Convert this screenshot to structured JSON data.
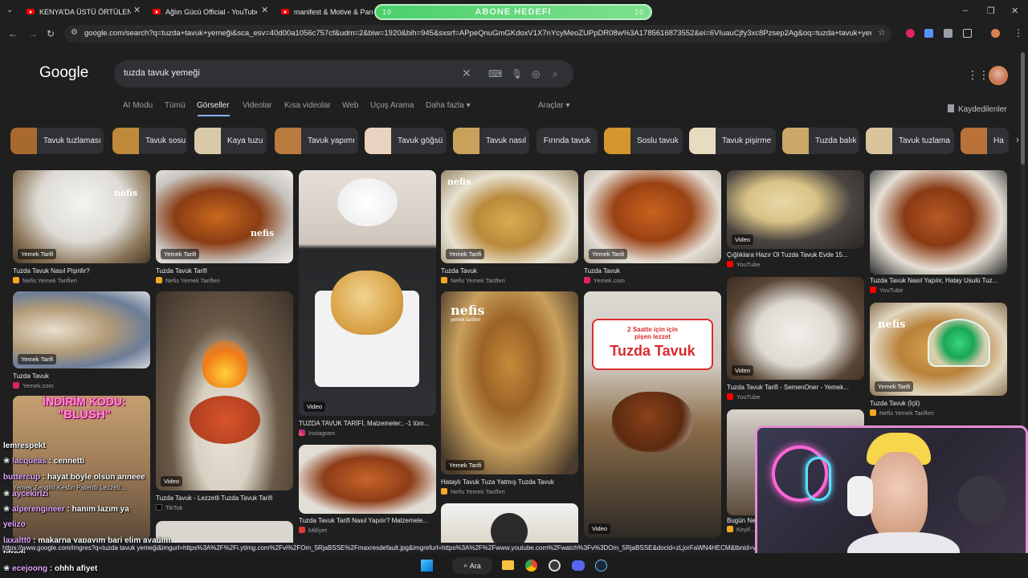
{
  "browser": {
    "tabs": [
      {
        "title": "KENYA'DA ÜSTÜ ÖRTÜLEN KOR"
      },
      {
        "title": "Ağlın Gücü Official - YouTube"
      },
      {
        "title": "manifest & Motive & Pango"
      }
    ],
    "overlay_banner": {
      "label": "ABONE HEDEFI",
      "left_num": "10",
      "right_num": "10"
    },
    "url": "google.com/search?q=tuzda+tavuk+yemeği&sca_esv=40d00a1056c757cf&udm=2&biw=1920&bih=945&sxsrf=APpeQnuGmGKdoxV1X7nYcyMeoZUPpDR08w%3A1785616873552&ei=6VIuauCjfy3xc8Pzsep2Ag&oq=tuzda+tavuk+yem..."
  },
  "google": {
    "logo": "Google",
    "query": "tuzda tavuk yemeği",
    "tabs": [
      "AI Modu",
      "Tümü",
      "Görseller",
      "Videolar",
      "Kısa videolar",
      "Web",
      "Uçuş Arama",
      "Daha fazla",
      "Araçlar"
    ],
    "active_tab": "Görseller",
    "saved": "Kaydedilenler",
    "chips": [
      "Tavuk tuzlaması",
      "Tavuk sosu",
      "Kaya tuzu",
      "Tavuk yapımı",
      "Tavuk göğsü",
      "Tavuk nasıl",
      "Fırında tavuk",
      "Soslu tavuk",
      "Tavuk pişirme",
      "Tuzda balık",
      "Tavuk tuzlama",
      "Ha"
    ],
    "results": [
      {
        "caption": "Tuzda Tavuk Nasıl Pişirilir?",
        "source": "Nefis Yemek Tarifleri",
        "badge": "Yemek Tarifi"
      },
      {
        "caption": "Tuzda Tavuk Tarifi",
        "source": "Nefis Yemek Tarifleri",
        "badge": "Yemek Tarifi"
      },
      {
        "caption": "TUZDA TAVUK TARİFİ, Malzemeler:, -1 tüm...",
        "source": "Instagram",
        "badge": "Video"
      },
      {
        "caption": "Tuzda Tavuk",
        "source": "Nefis Yemek Tarifleri",
        "badge": "Yemek Tarifi"
      },
      {
        "caption": "Tuzda Tavuk",
        "source": "Yemek.com",
        "badge": "Yemek Tarifi"
      },
      {
        "caption": "Çığlıklara Hazır Ol Tuzda Tavuk Evde 15...",
        "source": "YouTube",
        "badge": "Video"
      },
      {
        "caption": "Tuzda Tavuk Nasıl Yapılır, Hatay Usulü Tuz...",
        "source": "YouTube",
        "badge": ""
      },
      {
        "caption": "Tuzda Tavuk",
        "source": "Yemek.com",
        "badge": "Yemek Tarifi"
      },
      {
        "caption": "Tuzda Tavuk - Lezzetli Tuzda Tavuk Tarifi",
        "source": "TikTok",
        "badge": "Video"
      },
      {
        "caption": "Hataylı Tavuk Tuza Yatmış Tuzda Tavuk",
        "source": "Nefis Yemek Tarifleri",
        "badge": "Yemek Tarifi"
      },
      {
        "caption": "Tuzda Tavuk Tarifi - SemenOner - Yemek...",
        "source": "YouTube",
        "badge": "Video"
      },
      {
        "caption": "Tuzda Tavuk (İçli)",
        "source": "Nefis Yemek Tarifleri",
        "badge": "Yemek Tarifi"
      },
      {
        "caption": "Tuzda Tavuk Tarifi Nasıl Yapılır? Malzemele...",
        "source": "Milliyet",
        "badge": ""
      },
      {
        "caption": "Bugün Ne...",
        "source": "Keyif...",
        "badge": ""
      }
    ],
    "overlay_text": {
      "line1": "2 Saatte için için",
      "line2": "pişen lezzet",
      "line3": "Tuzda Tavuk",
      "nefis": "nefis",
      "nefis_sub": "yemek tarifleri",
      "video": "Video"
    }
  },
  "stream": {
    "promo": {
      "line1": "İNDİRİM KODU:",
      "line2": "\"BLUSH\""
    },
    "chat": [
      {
        "user": "",
        "msg": "lemrespekt"
      },
      {
        "user": "lacqueas",
        "msg": ": cennetti"
      },
      {
        "user": "buttercup",
        "msg": ": hayat böyle olsun anneee"
      },
      {
        "user": "",
        "msg": "Yemek Zengini Kestin Patentli Lezzeti:..."
      },
      {
        "user": "",
        "msg": "aycekirlzi"
      },
      {
        "user": "alperengineer",
        "msg": ": hanım lazım ya"
      },
      {
        "user": "yelizo",
        "msg": ""
      },
      {
        "user": "laxaltt0",
        "msg": ": makarna yapayım bari elim ayağım"
      },
      {
        "user": "",
        "msg": "titredi"
      },
      {
        "user": "ecejoong",
        "msg": ": ohhh afiyet"
      }
    ]
  },
  "status_url": "https://www.google.com/imgres?q=tuzda tavuk yemeği&imgurl=https%3A%2F%2Fi.ytimg.com%2Fvi%2FOm_5RjaBSSE%2Fmaxresdefault.jpg&imgrefurl=https%3A%2F%2Fwww.youtube.com%2Fwatch%3Fv%3DOm_5RjaBSSE&docid=zLjorFaWN4HECM&tbnid=vLZay...",
  "taskbar": {
    "search": "Ara"
  }
}
